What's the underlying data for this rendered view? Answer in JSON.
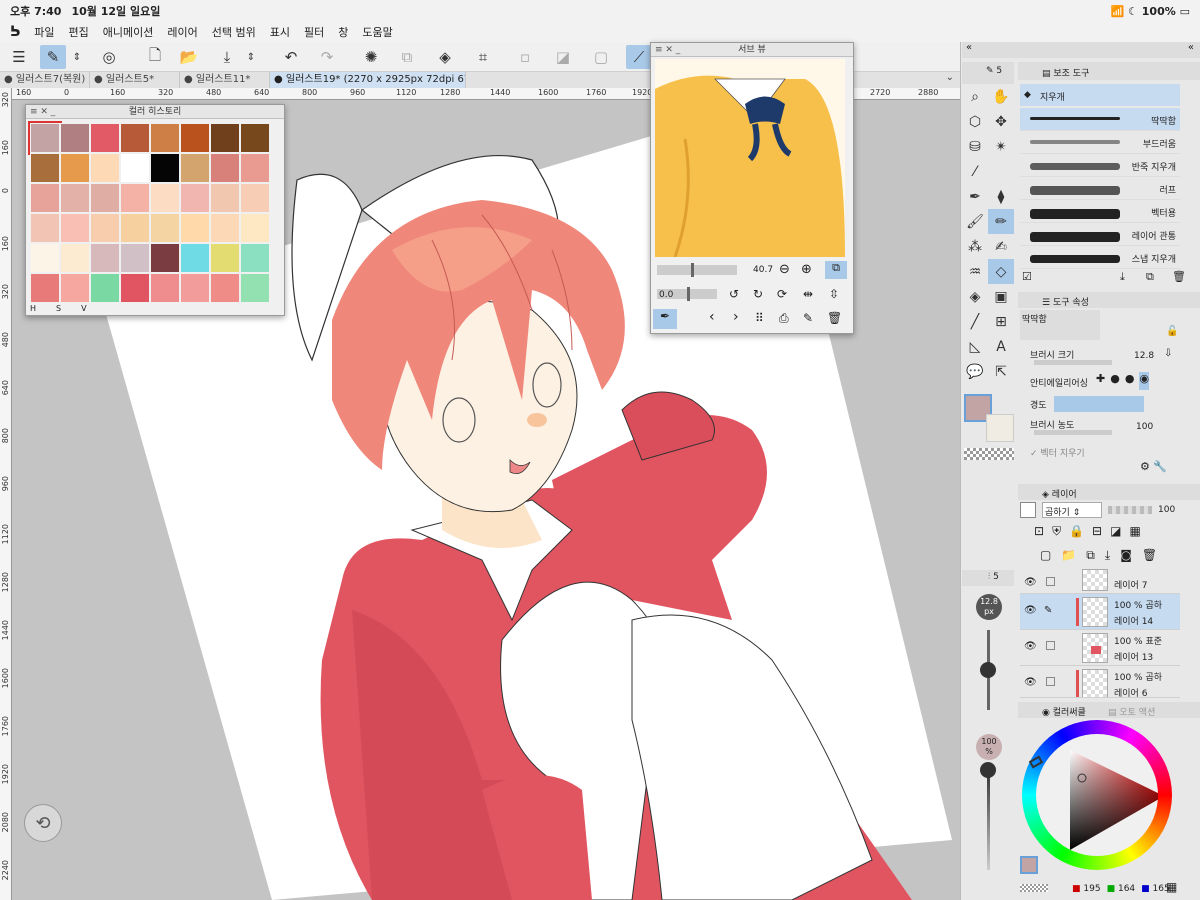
{
  "status": {
    "time": "오후 7:40",
    "date": "10월 12일 일요일",
    "battery": "100%"
  },
  "menu": [
    "파일",
    "편집",
    "애니메이션",
    "레이어",
    "선택 범위",
    "표시",
    "필터",
    "창",
    "도움말"
  ],
  "tabs": [
    {
      "label": "일러스트7(복원)",
      "active": false
    },
    {
      "label": "일러스트5*",
      "active": false
    },
    {
      "label": "일러스트11*",
      "active": false
    },
    {
      "label": "일러스트19* (2270 x 2925px 72dpi 67.4%)",
      "active": true
    }
  ],
  "ruler_top": [
    "160",
    "0",
    "160",
    "320",
    "480",
    "640",
    "800",
    "960",
    "1120",
    "1280",
    "1440",
    "1600",
    "1760",
    "1920",
    "2080",
    "2240",
    "2400",
    "2560",
    "2720",
    "2880"
  ],
  "ruler_left": [
    "320",
    "160",
    "0",
    "160",
    "320",
    "480",
    "640",
    "800",
    "960",
    "1120",
    "1280",
    "1440",
    "1600",
    "1760",
    "1920",
    "2080",
    "2240"
  ],
  "color_history": {
    "title": "컬러 히스토리",
    "hsv_labels": [
      "H",
      "S",
      "V"
    ],
    "swatches": [
      "#c4a3a5",
      "#b07f82",
      "#e15a66",
      "#b75a37",
      "#cd7f45",
      "#b9521d",
      "#70401d",
      "#77481c",
      "#a86f3d",
      "#e69a4c",
      "#fdd9b6",
      "#ffffff",
      "#050505",
      "#d4a46f",
      "#d8807a",
      "#e99b91",
      "#e7a39a",
      "#e3b1a8",
      "#e0ada5",
      "#f4b1a6",
      "#fcdcc3",
      "#f2b6b0",
      "#f1c7b0",
      "#f7ceb5",
      "#f2c4b3",
      "#f9bfb4",
      "#f7cdae",
      "#f6d09e",
      "#f4d4a3",
      "#ffd9aa",
      "#fcd8b6",
      "#fee7c3",
      "#fdf4e8",
      "#fcebd0",
      "#d7b8bb",
      "#d1c0c5",
      "#7a3b41",
      "#6fdce5",
      "#e2dc71",
      "#8ae0c1",
      "#e87b7a",
      "#f5a7a0",
      "#7ad9a2",
      "#e15563",
      "#ef8c8d",
      "#f29d9b",
      "#ef8c87",
      "#93e0b0"
    ]
  },
  "sub_view": {
    "title": "서브 뷰",
    "zoom": "40.7",
    "rotation": "0.0"
  },
  "sub_tool": {
    "tab": "보조 도구",
    "group": "지우개",
    "brushes": [
      "딱딱함",
      "부드러움",
      "반죽 지우개",
      "러프",
      "벡터용",
      "레이어 관통",
      "스냅 지우개"
    ]
  },
  "tool_property": {
    "tab": "도구 속성",
    "preset": "딱딱함",
    "brush_size_label": "브러시 크기",
    "brush_size": "12.8",
    "antialias_label": "안티에일리어싱",
    "hardness_label": "경도",
    "density_label": "브러시 농도",
    "density": "100",
    "vector_label": "벡터 지우기"
  },
  "layer_panel": {
    "tab": "레이어",
    "blend_mode": "곱하기",
    "opacity": "100",
    "layers": [
      {
        "name": "레이어 7",
        "info": ""
      },
      {
        "name": "레이어 14",
        "info": "100 % 곱하"
      },
      {
        "name": "레이어 13",
        "info": "100 % 표준"
      },
      {
        "name": "레이어 6",
        "info": "100 % 곱하"
      }
    ]
  },
  "brush_slider": {
    "size": "12.8",
    "unit": "px",
    "opacity": "100",
    "opacity_unit": "%"
  },
  "color_wheel": {
    "tab": "컬러써클",
    "tab2": "오토 액션",
    "r": "195",
    "g": "164",
    "b": "165",
    "current_color": "#c3a4a5"
  }
}
